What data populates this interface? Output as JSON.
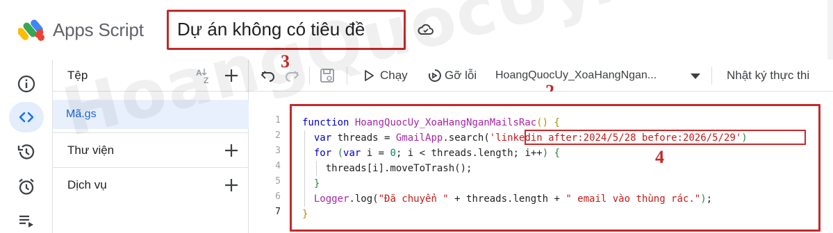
{
  "header": {
    "app_name": "Apps Script",
    "project_title": "Dự án không có tiêu đề"
  },
  "rail": {
    "items": [
      {
        "name": "overview",
        "icon": "info-icon"
      },
      {
        "name": "editor",
        "icon": "code-icon",
        "active": true
      },
      {
        "name": "executions",
        "icon": "history-icon"
      },
      {
        "name": "triggers",
        "icon": "alarm-icon"
      },
      {
        "name": "runs",
        "icon": "list-play-icon"
      }
    ]
  },
  "files": {
    "header_label": "Tệp",
    "active_file": "Mã.gs",
    "libraries_label": "Thư viện",
    "services_label": "Dịch vụ"
  },
  "toolbar": {
    "run_label": "Chạy",
    "debug_label": "Gỡ lỗi",
    "function_select": "HoangQuocUy_XoaHangNgan...",
    "log_label": "Nhật ký thực thi"
  },
  "markers": {
    "m2": "2",
    "m3": "3",
    "m4": "4"
  },
  "editor": {
    "line_numbers": [
      "1",
      "2",
      "3",
      "4",
      "5",
      "6",
      "7"
    ],
    "lines": [
      "function HoangQuocUy_XoaHangNganMailsRac() {",
      "  var threads = GmailApp.search('linkedin after:2024/5/28 before:2026/5/29')",
      "  for (var i = 0; i < threads.length; i++) {",
      "    threads[i].moveToTrash();",
      "  }",
      "  Logger.log(\"Đã chuyển \" + threads.length + \" email vào thùng rác.\");",
      "}"
    ],
    "tokens": {
      "function_kw": "function",
      "function_name": "HoangQuocUy_XoaHangNganMailsRac",
      "var_kw": "var",
      "threads": "threads",
      "gmailapp": "GmailApp",
      "search_method": ".search(",
      "query": "linkedin after:2024/5/28 before:2026/5/29",
      "for_kw": "for",
      "i": "i",
      "zero": "0",
      "length_expr": "threads.length",
      "move_call": "threads[i].moveToTrash();",
      "logger": "Logger",
      "log_call": ".log(",
      "log_str1": "\"Đã chuyển \"",
      "log_str2": "\" email vào thùng rác.\""
    }
  },
  "watermark": "HoangQuocUy.Com",
  "colors": {
    "accent_blue": "#1a73e8",
    "annotation_red": "#c62828",
    "active_file_bg": "#e8f0fe"
  }
}
